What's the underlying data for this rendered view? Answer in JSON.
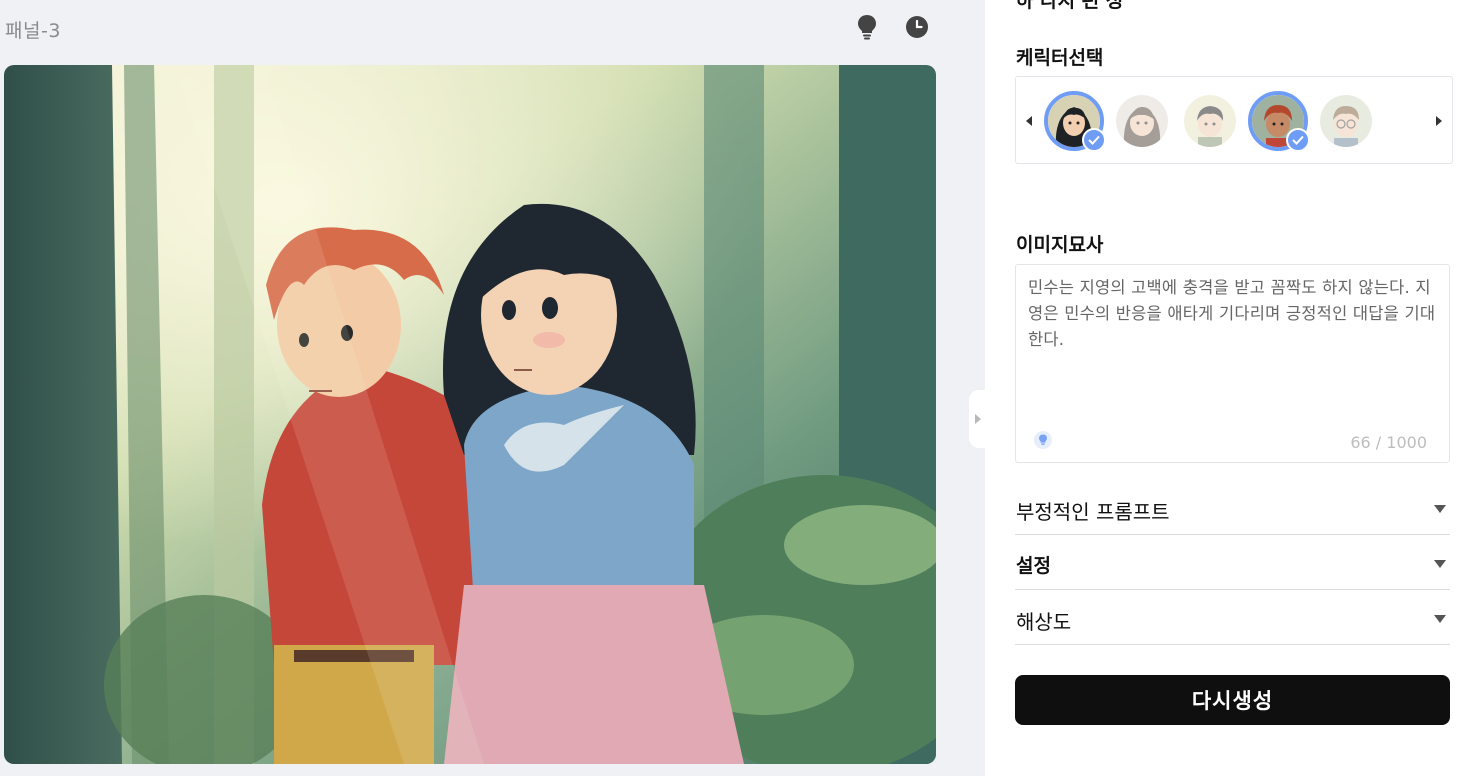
{
  "panel": {
    "title": "패널-3",
    "icons": [
      "lightbulb-icon",
      "history-clock-icon"
    ]
  },
  "sidebar": {
    "top_cut_label": "하 다시 편 성",
    "character_section": {
      "label": "케릭터선택",
      "characters": [
        {
          "name": "girl-black-hair",
          "selected": true
        },
        {
          "name": "girl-brown-hair",
          "selected": false
        },
        {
          "name": "boy-dark-hair",
          "selected": false
        },
        {
          "name": "boy-red-hair",
          "selected": true
        },
        {
          "name": "boy-glasses",
          "selected": false
        }
      ]
    },
    "description_section": {
      "label": "이미지묘사",
      "text": "민수는 지영의 고백에 충격을 받고 꼼짝도 하지 않는다. 지영은 민수의 반응을 애타게 기다리며 긍정적인 대답을 기대한다.",
      "counter": "66 / 1000"
    },
    "accordions": [
      {
        "label": "부정적인 프롬프트"
      },
      {
        "label": "설정"
      },
      {
        "label": "해상도"
      }
    ],
    "regenerate_label": "다시생성"
  },
  "colors": {
    "accent": "#6f9cf5",
    "button_bg": "#0f0f0f",
    "page_bg": "#f0f1f5"
  }
}
